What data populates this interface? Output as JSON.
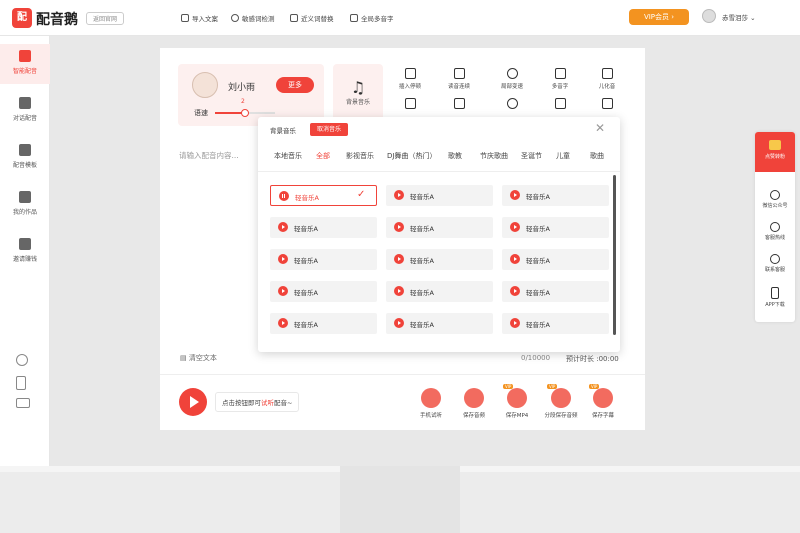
{
  "header": {
    "logo_char": "配",
    "app_name": "配音鹅",
    "back_label": "返回官网",
    "menu": [
      "导入文案",
      "敏感词检测",
      "近义词替换",
      "全局多音字"
    ],
    "vip_label": "VIP会员 ›",
    "username": "赤雪泪莎"
  },
  "sidebar": {
    "items": [
      "智能配音",
      "对话配音",
      "配音模板",
      "我的作品",
      "邀请赚钱"
    ]
  },
  "speaker": {
    "name": "刘小雨",
    "more_label": "更多",
    "speed_label": "语速",
    "speed_value": "2",
    "speed_fraction": 0.45
  },
  "bg_music": {
    "label": "背景音乐"
  },
  "tools": [
    {
      "label": "插入停顿",
      "icon": "pause-insert-icon"
    },
    {
      "label": "读音连续",
      "icon": "continuous-read-icon"
    },
    {
      "label": "局部变速",
      "icon": "local-speed-icon"
    },
    {
      "label": "多音字",
      "icon": "polyphone-icon"
    },
    {
      "label": "儿化音",
      "icon": "erhua-icon"
    },
    {
      "label": "",
      "icon": "music-icon"
    },
    {
      "label": "",
      "icon": "voice-icon"
    },
    {
      "label": "",
      "icon": "timer-icon"
    },
    {
      "label": "",
      "icon": "headphone-icon"
    },
    {
      "label": "",
      "icon": "loop-icon"
    }
  ],
  "editor": {
    "placeholder": "请输入配音内容...",
    "clear_label": "清空文本",
    "counter": "0/10000",
    "duration": "预计时长 :00:00"
  },
  "player": {
    "hint_prefix": "点击按钮即可",
    "hint_highlight": "试听",
    "hint_suffix": "配音~",
    "actions": [
      {
        "label": "手机试听",
        "vip": false
      },
      {
        "label": "保存音频",
        "vip": false
      },
      {
        "label": "保存MP4",
        "vip": true
      },
      {
        "label": "分段保存音频",
        "vip": true
      },
      {
        "label": "保存字幕",
        "vip": true
      }
    ],
    "vip_tag": "VIP"
  },
  "popup": {
    "title": "背景音乐",
    "cancel_label": "取消音乐",
    "categories": [
      "本地音乐",
      "全部",
      "影视音乐",
      "DJ舞曲（热门）",
      "歌教",
      "节庆歌曲",
      "圣诞节",
      "儿童",
      "歌曲"
    ],
    "active_category": 1,
    "tracks": [
      "轻音乐A",
      "轻音乐A",
      "轻音乐A",
      "轻音乐A",
      "轻音乐A",
      "轻音乐A",
      "轻音乐A",
      "轻音乐A",
      "轻音乐A",
      "轻音乐A",
      "轻音乐A",
      "轻音乐A",
      "轻音乐A",
      "轻音乐A",
      "轻音乐A"
    ],
    "selected_track": 0
  },
  "right_panel": {
    "top_label": "点赞转粉",
    "items": [
      "微信公众号",
      "客服热线",
      "联系客服",
      "APP下载"
    ]
  },
  "colors": {
    "accent": "#f0433a",
    "vip": "#f39320"
  }
}
